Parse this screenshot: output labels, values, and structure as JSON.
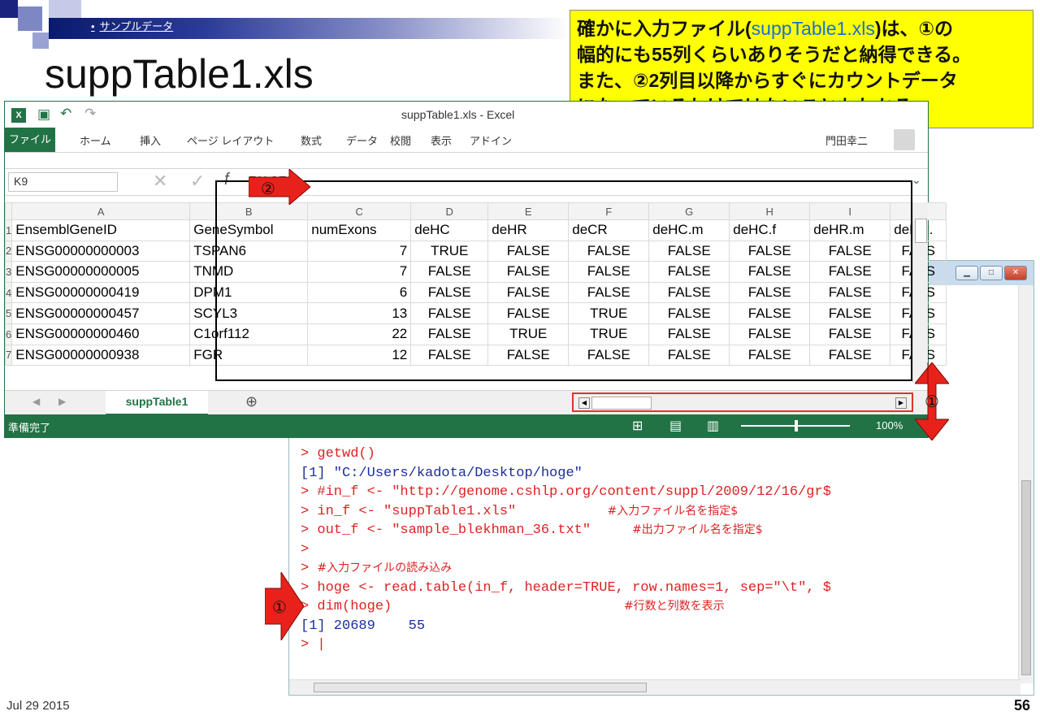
{
  "slide": {
    "breadcrumb": "サンプルデータ",
    "title": "suppTable1.xls",
    "date": "Jul 29 2015",
    "page_number": "56",
    "note_lines": [
      {
        "pre": "確かに入力ファイル(",
        "blue": "suppTable1.xls",
        "post": ")は、①の"
      },
      {
        "pre": "幅的にも55列くらいありそうだと納得できる。",
        "blue": "",
        "post": ""
      },
      {
        "pre": "また、②2列目以降からすぐにカウントデータ",
        "blue": "",
        "post": ""
      },
      {
        "pre": "になっているわけではないこともわかる。",
        "blue": "",
        "post": ""
      }
    ],
    "marker_1": "①",
    "marker_2": "②"
  },
  "excel": {
    "window_title": "suppTable1.xls - Excel",
    "user": "門田幸二",
    "ribbon_tabs": [
      "ファイル",
      "ホーム",
      "挿入",
      "ページ レイアウト",
      "数式",
      "データ",
      "校閲",
      "表示",
      "アドイン"
    ],
    "name_box": "K9",
    "formula_value": "FALSE",
    "column_letters": [
      "A",
      "B",
      "C",
      "D",
      "E",
      "F",
      "G",
      "H",
      "I",
      "J"
    ],
    "rows": [
      {
        "n": "1",
        "cells": [
          "EnsemblGeneID",
          "GeneSymbol",
          "numExons",
          "deHC",
          "deHR",
          "deCR",
          "deHC.m",
          "deHC.f",
          "deHR.m",
          "deHR."
        ]
      },
      {
        "n": "2",
        "cells": [
          "ENSG00000000003",
          "TSPAN6",
          "7",
          "TRUE",
          "FALSE",
          "FALSE",
          "FALSE",
          "FALSE",
          "FALSE",
          "FALS"
        ]
      },
      {
        "n": "3",
        "cells": [
          "ENSG00000000005",
          "TNMD",
          "7",
          "FALSE",
          "FALSE",
          "FALSE",
          "FALSE",
          "FALSE",
          "FALSE",
          "FALS"
        ]
      },
      {
        "n": "4",
        "cells": [
          "ENSG00000000419",
          "DPM1",
          "6",
          "FALSE",
          "FALSE",
          "FALSE",
          "FALSE",
          "FALSE",
          "FALSE",
          "FALS"
        ]
      },
      {
        "n": "5",
        "cells": [
          "ENSG00000000457",
          "SCYL3",
          "13",
          "FALSE",
          "FALSE",
          "TRUE",
          "FALSE",
          "FALSE",
          "FALSE",
          "FALS"
        ]
      },
      {
        "n": "6",
        "cells": [
          "ENSG00000000460",
          "C1orf112",
          "22",
          "FALSE",
          "TRUE",
          "TRUE",
          "FALSE",
          "FALSE",
          "FALSE",
          "FALS"
        ]
      },
      {
        "n": "7",
        "cells": [
          "ENSG00000000938",
          "FGR",
          "12",
          "FALSE",
          "FALSE",
          "FALSE",
          "FALSE",
          "FALSE",
          "FALSE",
          "FALS"
        ]
      }
    ],
    "sheet_tab": "suppTable1",
    "add_sheet": "⊕",
    "status_ready": "準備完了",
    "zoom": "100%"
  },
  "rconsole": {
    "lines": [
      {
        "cls": "prompt",
        "text": "> getwd()",
        "comment": ""
      },
      {
        "cls": "out",
        "text": "[1] \"C:/Users/kadota/Desktop/hoge\"",
        "comment": ""
      },
      {
        "cls": "prompt",
        "text": "> #in_f <- \"http://genome.cshlp.org/content/suppl/2009/12/16/gr$",
        "comment": ""
      },
      {
        "cls": "prompt",
        "text": "> in_f <- \"suppTable1.xls\"           ",
        "comment": "#入力ファイル名を指定$"
      },
      {
        "cls": "prompt",
        "text": "> out_f <- \"sample_blekhman_36.txt\"     ",
        "comment": "#出力ファイル名を指定$"
      },
      {
        "cls": "prompt",
        "text": ">",
        "comment": ""
      },
      {
        "cls": "prompt",
        "text": "> ",
        "comment": "#入力ファイルの読み込み"
      },
      {
        "cls": "prompt",
        "text": "> hoge <- read.table(in_f, header=TRUE, row.names=1, sep=\"\\t\", $",
        "comment": ""
      },
      {
        "cls": "prompt",
        "text": "> dim(hoge)                            ",
        "comment": "#行数と列数を表示"
      },
      {
        "cls": "out",
        "text": "[1] 20689    55",
        "comment": ""
      },
      {
        "cls": "prompt",
        "text": "> |",
        "comment": ""
      }
    ]
  },
  "colors": {
    "excel_green": "#217346",
    "note_yellow": "#ffff00",
    "r_red": "#dd2222",
    "r_blue": "#1a2e9e"
  }
}
